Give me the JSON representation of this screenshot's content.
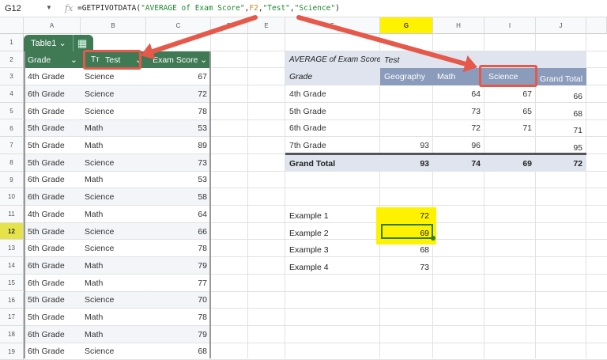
{
  "formula_bar": {
    "name_box": "G12",
    "fx": "fx",
    "formula_parts": [
      {
        "t": "=GETPIVOTDATA(",
        "c": ""
      },
      {
        "t": "\"AVERAGE of Exam Score\"",
        "c": "fs"
      },
      {
        "t": ",",
        "c": ""
      },
      {
        "t": "F2",
        "c": "fr"
      },
      {
        "t": ",",
        "c": ""
      },
      {
        "t": "\"Test\"",
        "c": "fs"
      },
      {
        "t": ",",
        "c": ""
      },
      {
        "t": "\"Science\"",
        "c": "fs"
      },
      {
        "t": ")",
        "c": ""
      }
    ]
  },
  "columns": [
    "A",
    "B",
    "C",
    "D",
    "E",
    "F",
    "G",
    "H",
    "I",
    "J"
  ],
  "selected_column": "G",
  "selected_row": 12,
  "table": {
    "name": "Table1",
    "headers": [
      "Grade",
      "Test",
      "Exam Score"
    ],
    "test_type_icon": "Tт",
    "rows": [
      [
        "4th Grade",
        "Science",
        "67"
      ],
      [
        "6th Grade",
        "Science",
        "72"
      ],
      [
        "6th Grade",
        "Science",
        "78"
      ],
      [
        "5th Grade",
        "Math",
        "53"
      ],
      [
        "5th Grade",
        "Math",
        "89"
      ],
      [
        "5th Grade",
        "Science",
        "73"
      ],
      [
        "6th Grade",
        "Math",
        "53"
      ],
      [
        "6th Grade",
        "Science",
        "58"
      ],
      [
        "4th Grade",
        "Math",
        "64"
      ],
      [
        "5th Grade",
        "Science",
        "66"
      ],
      [
        "6th Grade",
        "Science",
        "78"
      ],
      [
        "6th Grade",
        "Math",
        "79"
      ],
      [
        "6th Grade",
        "Math",
        "77"
      ],
      [
        "5th Grade",
        "Science",
        "70"
      ],
      [
        "5th Grade",
        "Math",
        "78"
      ],
      [
        "6th Grade",
        "Math",
        "79"
      ],
      [
        "6th Grade",
        "Science",
        "68"
      ]
    ]
  },
  "pivot": {
    "value_label": "AVERAGE of Exam Score",
    "column_field": "Test",
    "row_field": "Grade",
    "col_headers": [
      "Geography",
      "Math",
      "Science",
      "Grand Total"
    ],
    "rows": [
      [
        "4th Grade",
        "",
        "64",
        "67",
        "66"
      ],
      [
        "5th Grade",
        "",
        "73",
        "65",
        "68"
      ],
      [
        "6th Grade",
        "",
        "72",
        "71",
        "71"
      ],
      [
        "7th Grade",
        "93",
        "96",
        "",
        "95"
      ]
    ],
    "grand_total": [
      "Grand Total",
      "93",
      "74",
      "69",
      "72"
    ]
  },
  "examples": [
    [
      "Example 1",
      "72"
    ],
    [
      "Example 2",
      "69"
    ],
    [
      "Example 3",
      "68"
    ],
    [
      "Example 4",
      "73"
    ]
  ],
  "colors": {
    "table_green": "#3f7a55",
    "pivot_header": "#8a9bbb",
    "pivot_light": "#dfe4ee",
    "highlight": "#fff200",
    "arrow": "#e5584a"
  }
}
